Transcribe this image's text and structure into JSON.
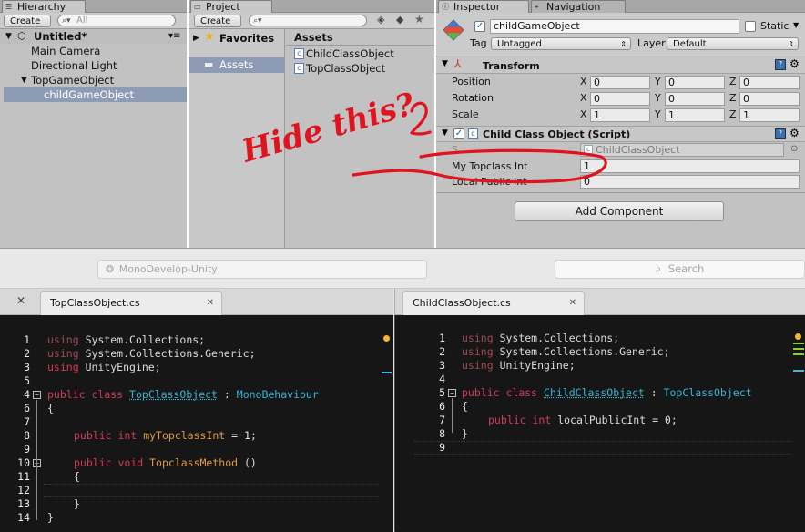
{
  "hierarchy": {
    "tab": "Hierarchy",
    "create": "Create",
    "search_placeholder": "All",
    "scene": "Untitled*",
    "items": [
      "Main Camera",
      "Directional Light",
      "TopGameObject",
      "childGameObject"
    ]
  },
  "project": {
    "tab": "Project",
    "create": "Create",
    "favorites": "Favorites",
    "assets_header": "Assets",
    "assets_folder": "Assets",
    "files": [
      "ChildClassObject",
      "TopClassObject"
    ]
  },
  "inspector": {
    "tabs": [
      "Inspector",
      "Navigation"
    ],
    "object_name": "childGameObject",
    "static_label": "Static",
    "tag_label": "Tag",
    "tag_value": "Untagged",
    "layer_label": "Layer",
    "layer_value": "Default",
    "transform": {
      "title": "Transform",
      "rows": [
        {
          "label": "Position",
          "x": "0",
          "y": "0",
          "z": "0"
        },
        {
          "label": "Rotation",
          "x": "0",
          "y": "0",
          "z": "0"
        },
        {
          "label": "Scale",
          "x": "1",
          "y": "1",
          "z": "1"
        }
      ],
      "axis_labels": [
        "X",
        "Y",
        "Z"
      ]
    },
    "script_component": {
      "title": "Child Class Object (Script)",
      "script_label": "S",
      "script_value": "ChildClassObject",
      "fields": [
        {
          "label": "My Topclass Int",
          "value": "1"
        },
        {
          "label": "Local Public Int",
          "value": "0"
        }
      ]
    },
    "add_component": "Add Component"
  },
  "annotation": {
    "text": "Hide this?"
  },
  "monodevelop": {
    "title": "MonoDevelop-Unity",
    "search_placeholder": "Search"
  },
  "editor_left": {
    "tab": "TopClassObject.cs",
    "line_numbers": [
      "1",
      "2",
      "3",
      "4",
      "5",
      "6",
      "7",
      "8",
      "9",
      "10",
      "11",
      "12",
      "13",
      "14"
    ]
  },
  "editor_right": {
    "tab": "ChildClassObject.cs",
    "line_numbers": [
      "1",
      "2",
      "3",
      "4",
      "5",
      "6",
      "7",
      "8",
      "9"
    ]
  },
  "code_tokens": {
    "using": "using",
    "public": "public",
    "class": "class",
    "int": "int",
    "void": "void",
    "ns1": "System.Collections;",
    "ns2": "System.Collections.Generic;",
    "ns3": "UnityEngine;",
    "top_class": "TopClassObject",
    "child_class": "ChildClassObject",
    "colon": " : ",
    "mono": "MonoBehaviour",
    "open_brace": "{",
    "close_brace": "}",
    "field_top": "myTopclassInt",
    "field_child": "localPublicInt",
    "assign": " = ",
    "one": "1",
    "zero": "0",
    "semi": ";",
    "method": "TopclassMethod",
    "parens": " ()"
  },
  "colors": {
    "keyword": "#d33a5a",
    "type": "#37b5d8",
    "method": "#e09a45",
    "annotation": "#e0141e"
  }
}
